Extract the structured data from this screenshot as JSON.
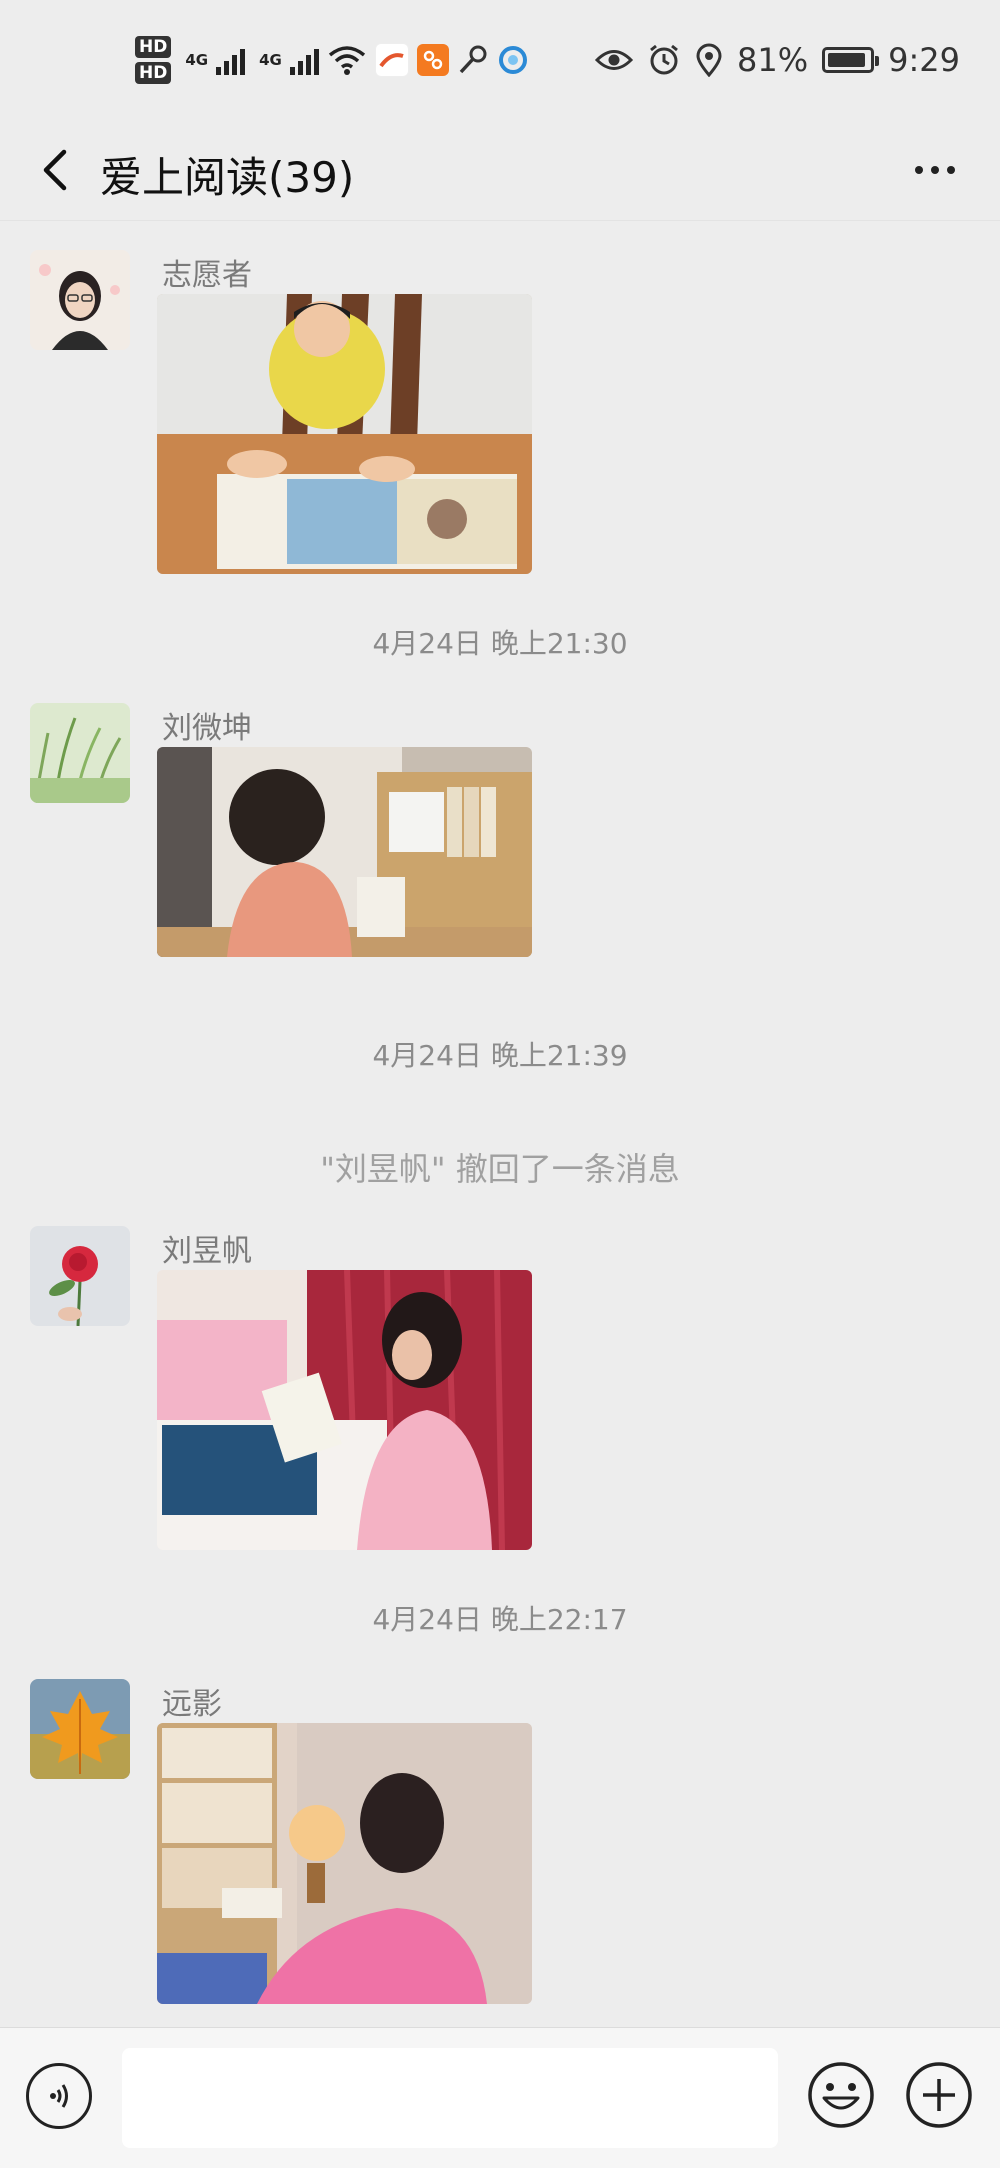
{
  "status_bar": {
    "hd1": "HD",
    "hd2": "HD",
    "net1": "4G",
    "net2": "4G",
    "battery_pct": "81%",
    "time": "9:29",
    "icons": [
      "wifi-icon",
      "app-icon-1",
      "app-icon-2",
      "key-icon",
      "app-icon-3",
      "eye-icon",
      "alarm-icon",
      "location-icon",
      "battery-icon"
    ]
  },
  "header": {
    "title": "爱上阅读(39)"
  },
  "messages": [
    {
      "sender": "志愿者"
    },
    {
      "sender": "刘微坤"
    },
    {
      "sender": "刘昱帆"
    },
    {
      "sender": "远影"
    }
  ],
  "timestamps": [
    "4月24日 晚上21:30",
    "4月24日 晚上21:39",
    "4月24日 晚上22:17"
  ],
  "system": {
    "recall": "\"刘昱帆\" 撤回了一条消息"
  },
  "colors": {
    "background": "#ededed",
    "input_bar": "#f6f6f6"
  }
}
